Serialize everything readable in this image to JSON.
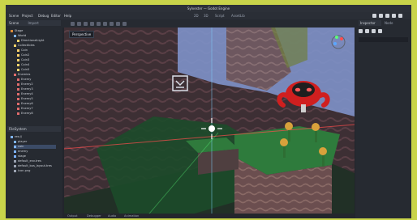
{
  "window": {
    "title": "Sylvester — Godot Engine"
  },
  "menu": [
    "Scene",
    "Project",
    "Debug",
    "Editor",
    "Help"
  ],
  "top_right": [
    "2D",
    "3D",
    "Script",
    "AssetLib"
  ],
  "left_panel": {
    "scene_tab": "Scene",
    "import_tab": "Import",
    "tree": [
      "Stage",
      "World",
      "DirectionalLight",
      "Collectibles",
      "Coin",
      "Coin2",
      "Coin3",
      "Coin4",
      "Coin5",
      "Enemies",
      "Enemy",
      "Enemy2",
      "Enemy3",
      "Enemy4",
      "Enemy5",
      "Enemy6",
      "Enemy7",
      "Enemy8"
    ],
    "filesystem_title": "FileSystem",
    "filesystem_items": [
      "res://",
      "player",
      "coin",
      "enemy",
      "stage",
      "default_env.tres",
      "default_bus_layout.tres",
      "icon.png"
    ]
  },
  "viewport": {
    "label": "Perspective"
  },
  "right_panel": {
    "inspector_tab": "Inspector",
    "node_tab": "Node"
  },
  "status": [
    "Output",
    "Debugger",
    "Audio",
    "Animation"
  ]
}
